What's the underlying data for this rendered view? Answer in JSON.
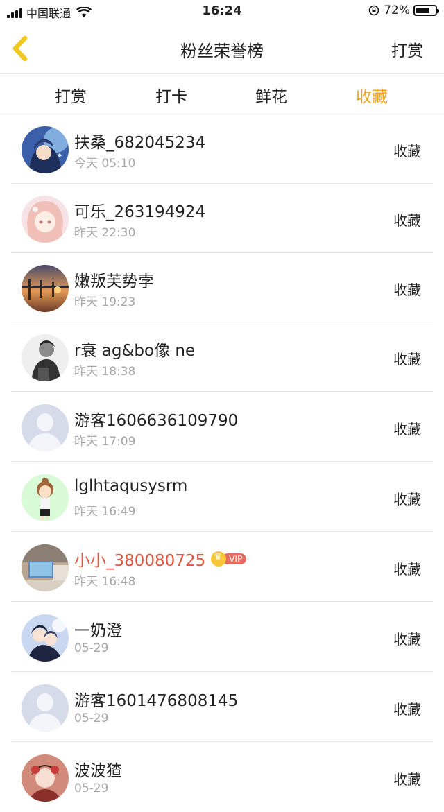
{
  "status_bar": {
    "carrier": "中国联通",
    "time": "16:24",
    "battery": "72%",
    "battery_level": 0.72
  },
  "nav": {
    "title": "粉丝荣誉榜",
    "action": "打赏"
  },
  "tabs": [
    {
      "label": "打赏",
      "active": false
    },
    {
      "label": "打卡",
      "active": false
    },
    {
      "label": "鲜花",
      "active": false
    },
    {
      "label": "收藏",
      "active": true
    }
  ],
  "colors": {
    "accent": "#f1a51c",
    "vip_name": "#e2553f",
    "secondary_text": "#a6a6a6"
  },
  "fans": [
    {
      "name": "扶桑_682045234",
      "time": "今天 05:10",
      "type": "收藏",
      "avatar": "anime-blue"
    },
    {
      "name": "可乐_263194924",
      "time": "昨天 22:30",
      "type": "收藏",
      "avatar": "anime-pink"
    },
    {
      "name": "嫩叛芙势孛",
      "time": "昨天 19:23",
      "type": "收藏",
      "avatar": "sunset-bridge"
    },
    {
      "name": "r衰 ag&bo像 ne",
      "time": "昨天 18:38",
      "type": "收藏",
      "avatar": "bw-portrait"
    },
    {
      "name": "游客1606636109790",
      "time": "昨天 17:09",
      "type": "收藏",
      "avatar": "placeholder"
    },
    {
      "name": "lglhtaqusysrm",
      "time": "昨天 16:49",
      "type": "收藏",
      "avatar": "cartoon-girl"
    },
    {
      "name": "小小_380080725",
      "time": "昨天 16:48",
      "type": "收藏",
      "avatar": "room-photo",
      "vip": true,
      "vip_label": "VIP"
    },
    {
      "name": "一奶澄",
      "time": "05-29",
      "type": "收藏",
      "avatar": "anime-couple"
    },
    {
      "name": "游客1601476808145",
      "time": "05-29",
      "type": "收藏",
      "avatar": "placeholder"
    },
    {
      "name": "波波猹",
      "time": "05-29",
      "type": "收藏",
      "avatar": "anime-red"
    }
  ]
}
